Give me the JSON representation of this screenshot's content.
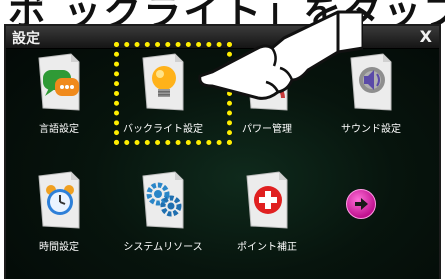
{
  "banner": {
    "text": "ボ ックライト」をタップ"
  },
  "window": {
    "title": "設定",
    "close_label": "X"
  },
  "tiles": [
    {
      "label": "言語設定",
      "icon": "speech-bubbles-icon"
    },
    {
      "label": "バックライト設定",
      "icon": "light-bulb-icon"
    },
    {
      "label": "パワー管理",
      "icon": "power-gauge-icon"
    },
    {
      "label": "サウンド設定",
      "icon": "speaker-icon"
    },
    {
      "label": "時間設定",
      "icon": "alarm-clock-icon"
    },
    {
      "label": "システムリソース",
      "icon": "gears-icon"
    },
    {
      "label": "ポイント補正",
      "icon": "red-cross-icon"
    }
  ],
  "next_button": {
    "icon": "arrow-right-icon"
  },
  "colors": {
    "highlight": "#ffee00",
    "label": "#ffffff",
    "background": "#07140d",
    "next_button": "#e01ca6"
  }
}
